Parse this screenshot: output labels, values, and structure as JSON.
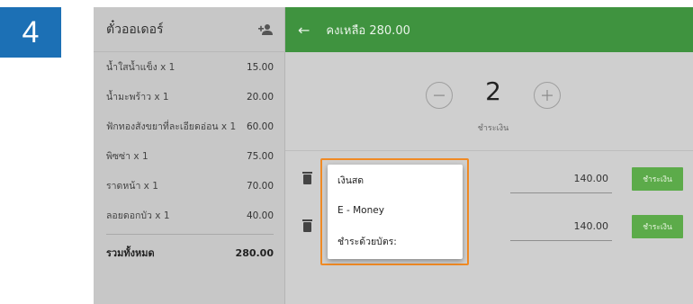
{
  "step": "4",
  "order": {
    "title": "ตั๋วออเดอร์",
    "items": [
      {
        "name": "น้ำใสน้ำแข็ง x 1",
        "price": "15.00"
      },
      {
        "name": "น้ำมะพร้าว x 1",
        "price": "20.00"
      },
      {
        "name": "ฟักทองสังขยาที่ละเอียดอ่อน x 1",
        "price": "60.00"
      },
      {
        "name": "พิซซ่า x 1",
        "price": "75.00"
      },
      {
        "name": "ราดหน้า x 1",
        "price": "70.00"
      },
      {
        "name": "ลอยดอกบัว x 1",
        "price": "40.00"
      }
    ],
    "total_label": "รวมทั้งหมด",
    "total_value": "280.00"
  },
  "payment": {
    "balance_label": "คงเหลือ 280.00",
    "split_count": "2",
    "split_caption": "ชำระเงิน",
    "rows": [
      {
        "amount": "140.00",
        "pay_label": "ชำระเงิน"
      },
      {
        "amount": "140.00",
        "pay_label": "ชำระเงิน"
      }
    ],
    "methods": [
      "เงินสด",
      "E - Money",
      "ชำระด้วยบัตร:"
    ]
  },
  "colors": {
    "header_green": "#3f933f",
    "pay_button": "#5cab4a",
    "highlight": "#f08a24",
    "step_badge": "#1c70b5"
  }
}
